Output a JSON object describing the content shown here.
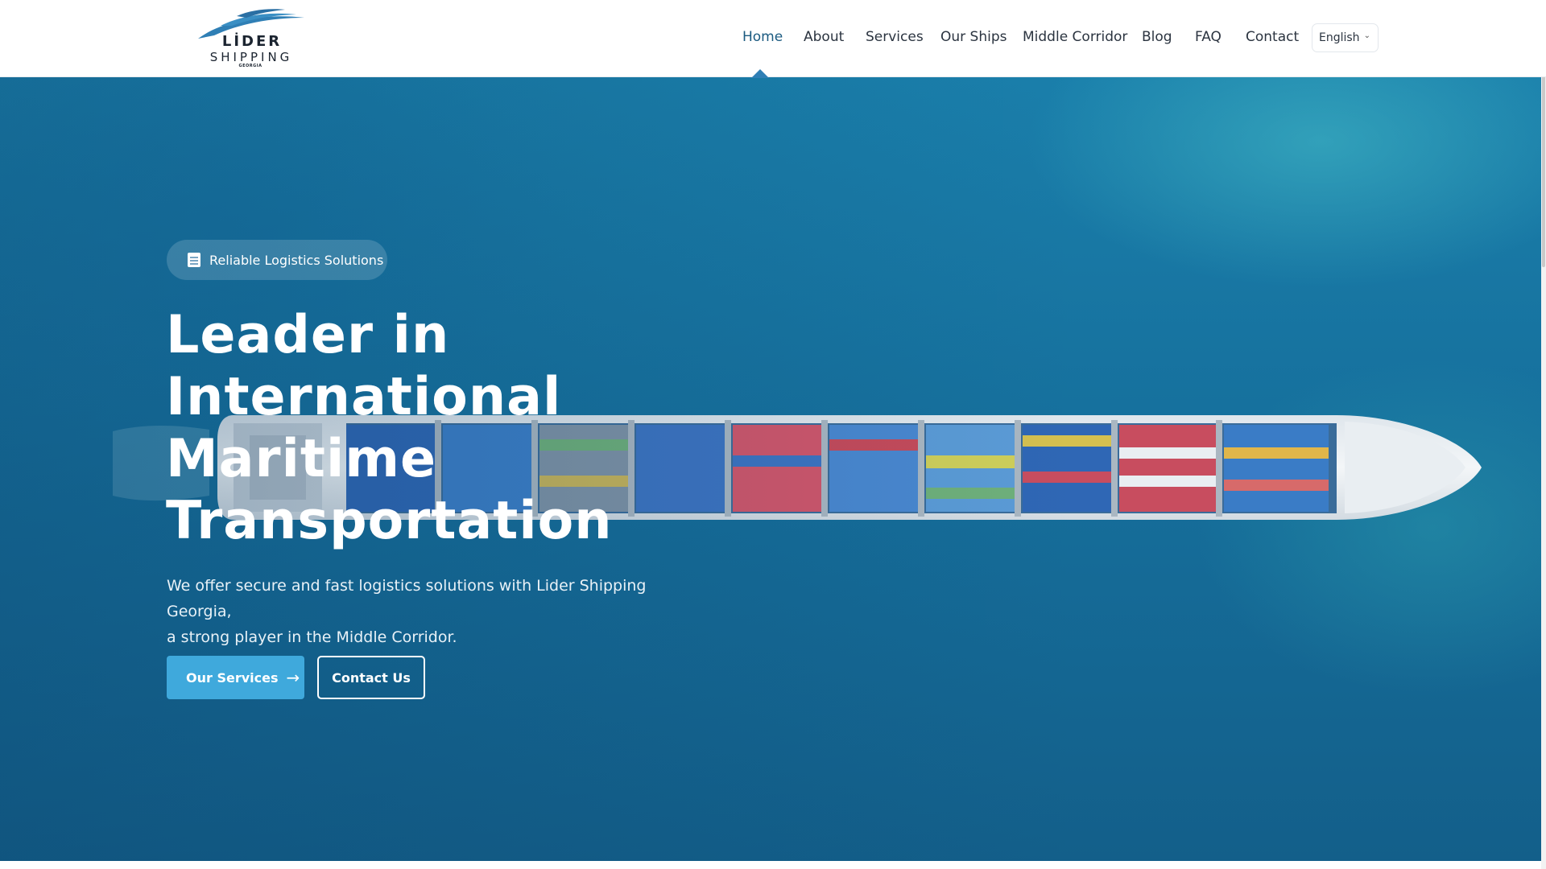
{
  "brand": {
    "logo_line1": "LİDER",
    "logo_line2": "SHIPPING",
    "logo_line3": "GEORGIA",
    "primary_color": "#3fa9dc",
    "nav_active_color": "#1a5a80"
  },
  "nav": {
    "items": [
      {
        "label": "Home",
        "active": true
      },
      {
        "label": "About"
      },
      {
        "label": "Services"
      },
      {
        "label": "Our Ships"
      },
      {
        "label": "Middle Corridor"
      },
      {
        "label": "Blog"
      },
      {
        "label": "FAQ"
      },
      {
        "label": "Contact"
      }
    ],
    "language": "English",
    "language_icon": "chevron-down-icon"
  },
  "hero": {
    "badge": "Reliable Logistics Solutions",
    "badge_icon": "document-icon",
    "title_lines": [
      "Leader in",
      "International",
      "Maritime",
      "Transportation"
    ],
    "subtitle_line1": "We offer secure and fast logistics solutions with Lider Shipping Georgia,",
    "subtitle_line2": "a strong player in the Middle Corridor.",
    "primary_button": "Our Services",
    "primary_button_icon": "arrow-right-icon",
    "secondary_button": "Contact Us",
    "background_image": "aerial view of container ship on blue sea"
  }
}
